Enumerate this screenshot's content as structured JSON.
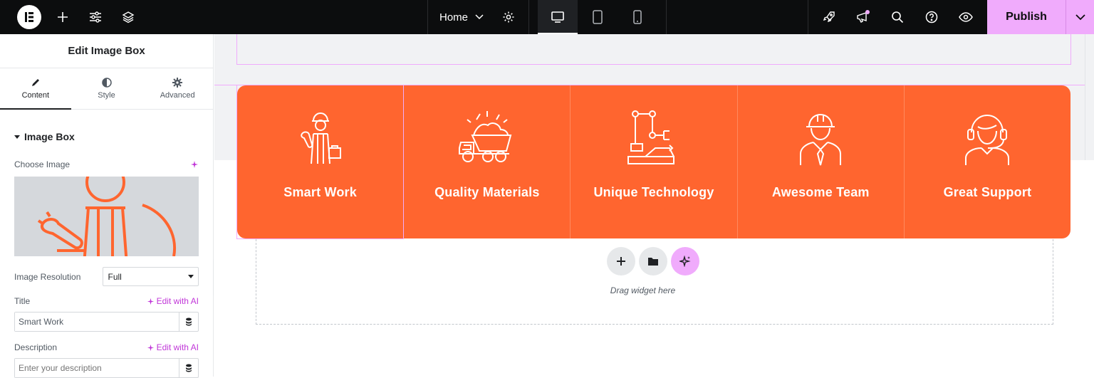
{
  "topbar": {
    "page_label": "Home",
    "publish_label": "Publish",
    "colors": {
      "bar": "#0c0d0e",
      "publish": "#f0abfc",
      "accent": "#c036d8"
    },
    "icons": [
      "elementor-logo-icon",
      "add-icon",
      "settings-sliders-icon",
      "layers-icon",
      "chevron-down-icon",
      "gear-icon",
      "desktop-icon",
      "tablet-icon",
      "mobile-icon",
      "rocket-icon",
      "megaphone-icon",
      "search-icon",
      "help-icon",
      "eye-icon"
    ]
  },
  "panel": {
    "title": "Edit Image Box",
    "tabs": [
      {
        "label": "Content",
        "icon": "pencil-icon"
      },
      {
        "label": "Style",
        "icon": "contrast-icon"
      },
      {
        "label": "Advanced",
        "icon": "gear-icon"
      }
    ],
    "section": "Image Box",
    "choose_image_label": "Choose Image",
    "resolution_label": "Image Resolution",
    "resolution_value": "Full",
    "title_label": "Title",
    "edit_with_ai": "Edit with AI",
    "title_value": "Smart Work",
    "description_label": "Description",
    "description_placeholder": "Enter your description"
  },
  "canvas": {
    "boxes": [
      {
        "title": "Smart Work",
        "icon": "worker-tools-icon"
      },
      {
        "title": "Quality Materials",
        "icon": "dump-truck-icon"
      },
      {
        "title": "Unique Technology",
        "icon": "robot-arm-icon"
      },
      {
        "title": "Awesome Team",
        "icon": "engineer-icon"
      },
      {
        "title": "Great Support",
        "icon": "support-agent-icon"
      }
    ],
    "box_color": "#ff652f",
    "drag_text": "Drag widget here"
  }
}
